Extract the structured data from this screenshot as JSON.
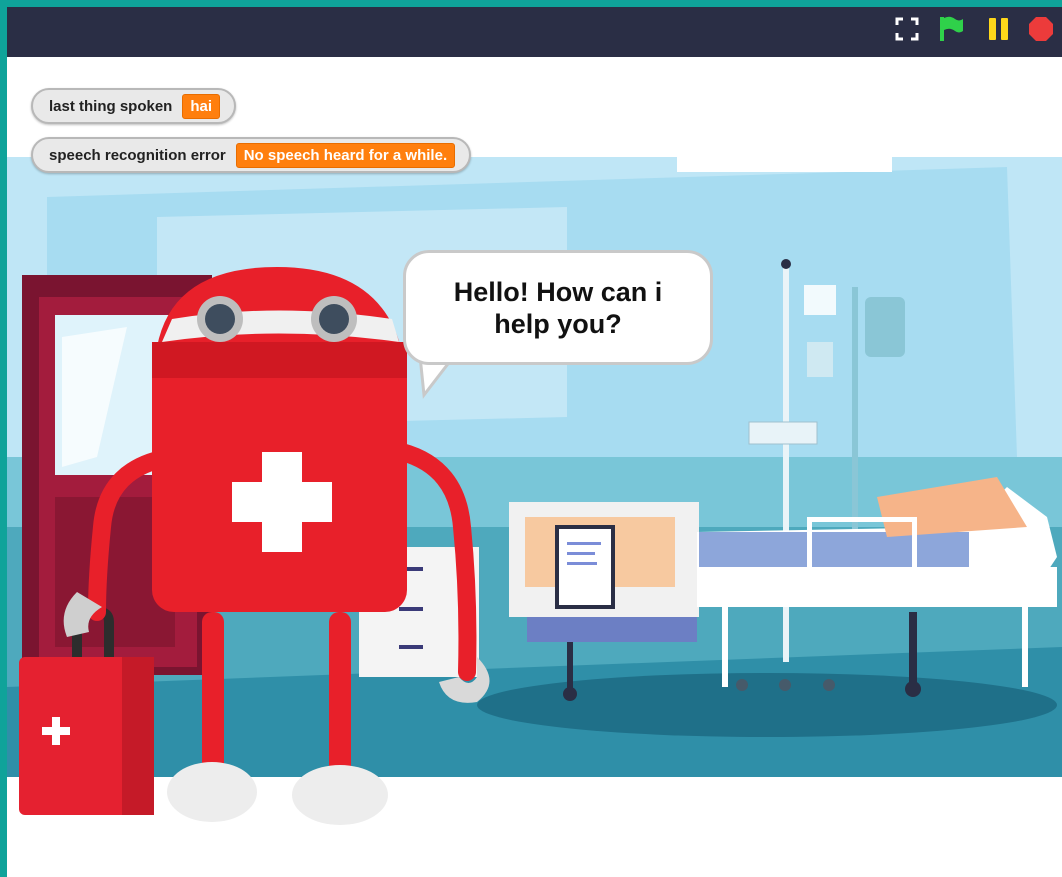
{
  "controls": {
    "fullscreen_icon": "fullscreen-icon",
    "flag_icon": "green-flag-icon",
    "pause_icon": "pause-icon",
    "stop_icon": "stop-icon"
  },
  "monitors": {
    "last_spoken": {
      "label": "last thing spoken",
      "value": "hai"
    },
    "speech_error": {
      "label": "speech recognition error",
      "value": "No speech heard for a while."
    }
  },
  "sprite": {
    "speech": "Hello!  How can i help you?"
  },
  "colors": {
    "topbar": "#2a2e45",
    "monitor_value": "#ff7f0e",
    "robot_red": "#e8202a",
    "flag_green": "#2fd14a",
    "pause_yellow": "#ffd81a",
    "stop_red": "#ec3b3b"
  }
}
